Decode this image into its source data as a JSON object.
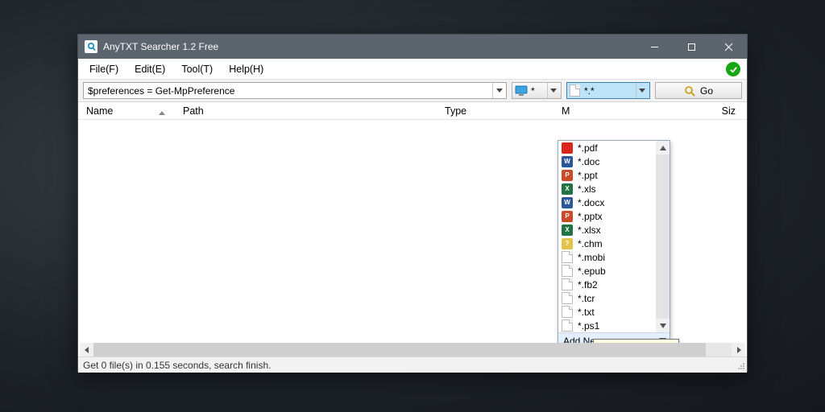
{
  "title": "AnyTXT Searcher 1.2 Free",
  "menu": {
    "file": "File(F)",
    "edit": "Edit(E)",
    "tool": "Tool(T)",
    "help": "Help(H)"
  },
  "toolbar": {
    "search_value": "$preferences = Get-MpPreference",
    "volume_label": "*",
    "filter_label": "*.*",
    "go_label": "Go"
  },
  "columns": {
    "name": "Name",
    "path": "Path",
    "type": "Type",
    "modified": "M",
    "size": "Siz"
  },
  "file_types": {
    "items": [
      {
        "label": "*.pdf",
        "iconcls": "b-pdf",
        "glyph": ""
      },
      {
        "label": "*.doc",
        "iconcls": "b-doc",
        "glyph": "W"
      },
      {
        "label": "*.ppt",
        "iconcls": "b-ppt",
        "glyph": "P"
      },
      {
        "label": "*.xls",
        "iconcls": "b-xls",
        "glyph": "X"
      },
      {
        "label": "*.docx",
        "iconcls": "b-docx",
        "glyph": "W"
      },
      {
        "label": "*.pptx",
        "iconcls": "b-pptx",
        "glyph": "P"
      },
      {
        "label": "*.xlsx",
        "iconcls": "b-xlsx",
        "glyph": "X"
      },
      {
        "label": "*.chm",
        "iconcls": "b-chm",
        "glyph": "?"
      },
      {
        "label": "*.mobi",
        "iconcls": "plain",
        "glyph": ""
      },
      {
        "label": "*.epub",
        "iconcls": "plain",
        "glyph": ""
      },
      {
        "label": "*.fb2",
        "iconcls": "plain",
        "glyph": ""
      },
      {
        "label": "*.tcr",
        "iconcls": "plain",
        "glyph": ""
      },
      {
        "label": "*.txt",
        "iconcls": "plain",
        "glyph": ""
      },
      {
        "label": "*.ps1",
        "iconcls": "plain",
        "glyph": ""
      }
    ],
    "add_label": "Add New"
  },
  "tooltip": "Add new file type.",
  "status": "Get 0 file(s) in 0.155 seconds, search finish."
}
